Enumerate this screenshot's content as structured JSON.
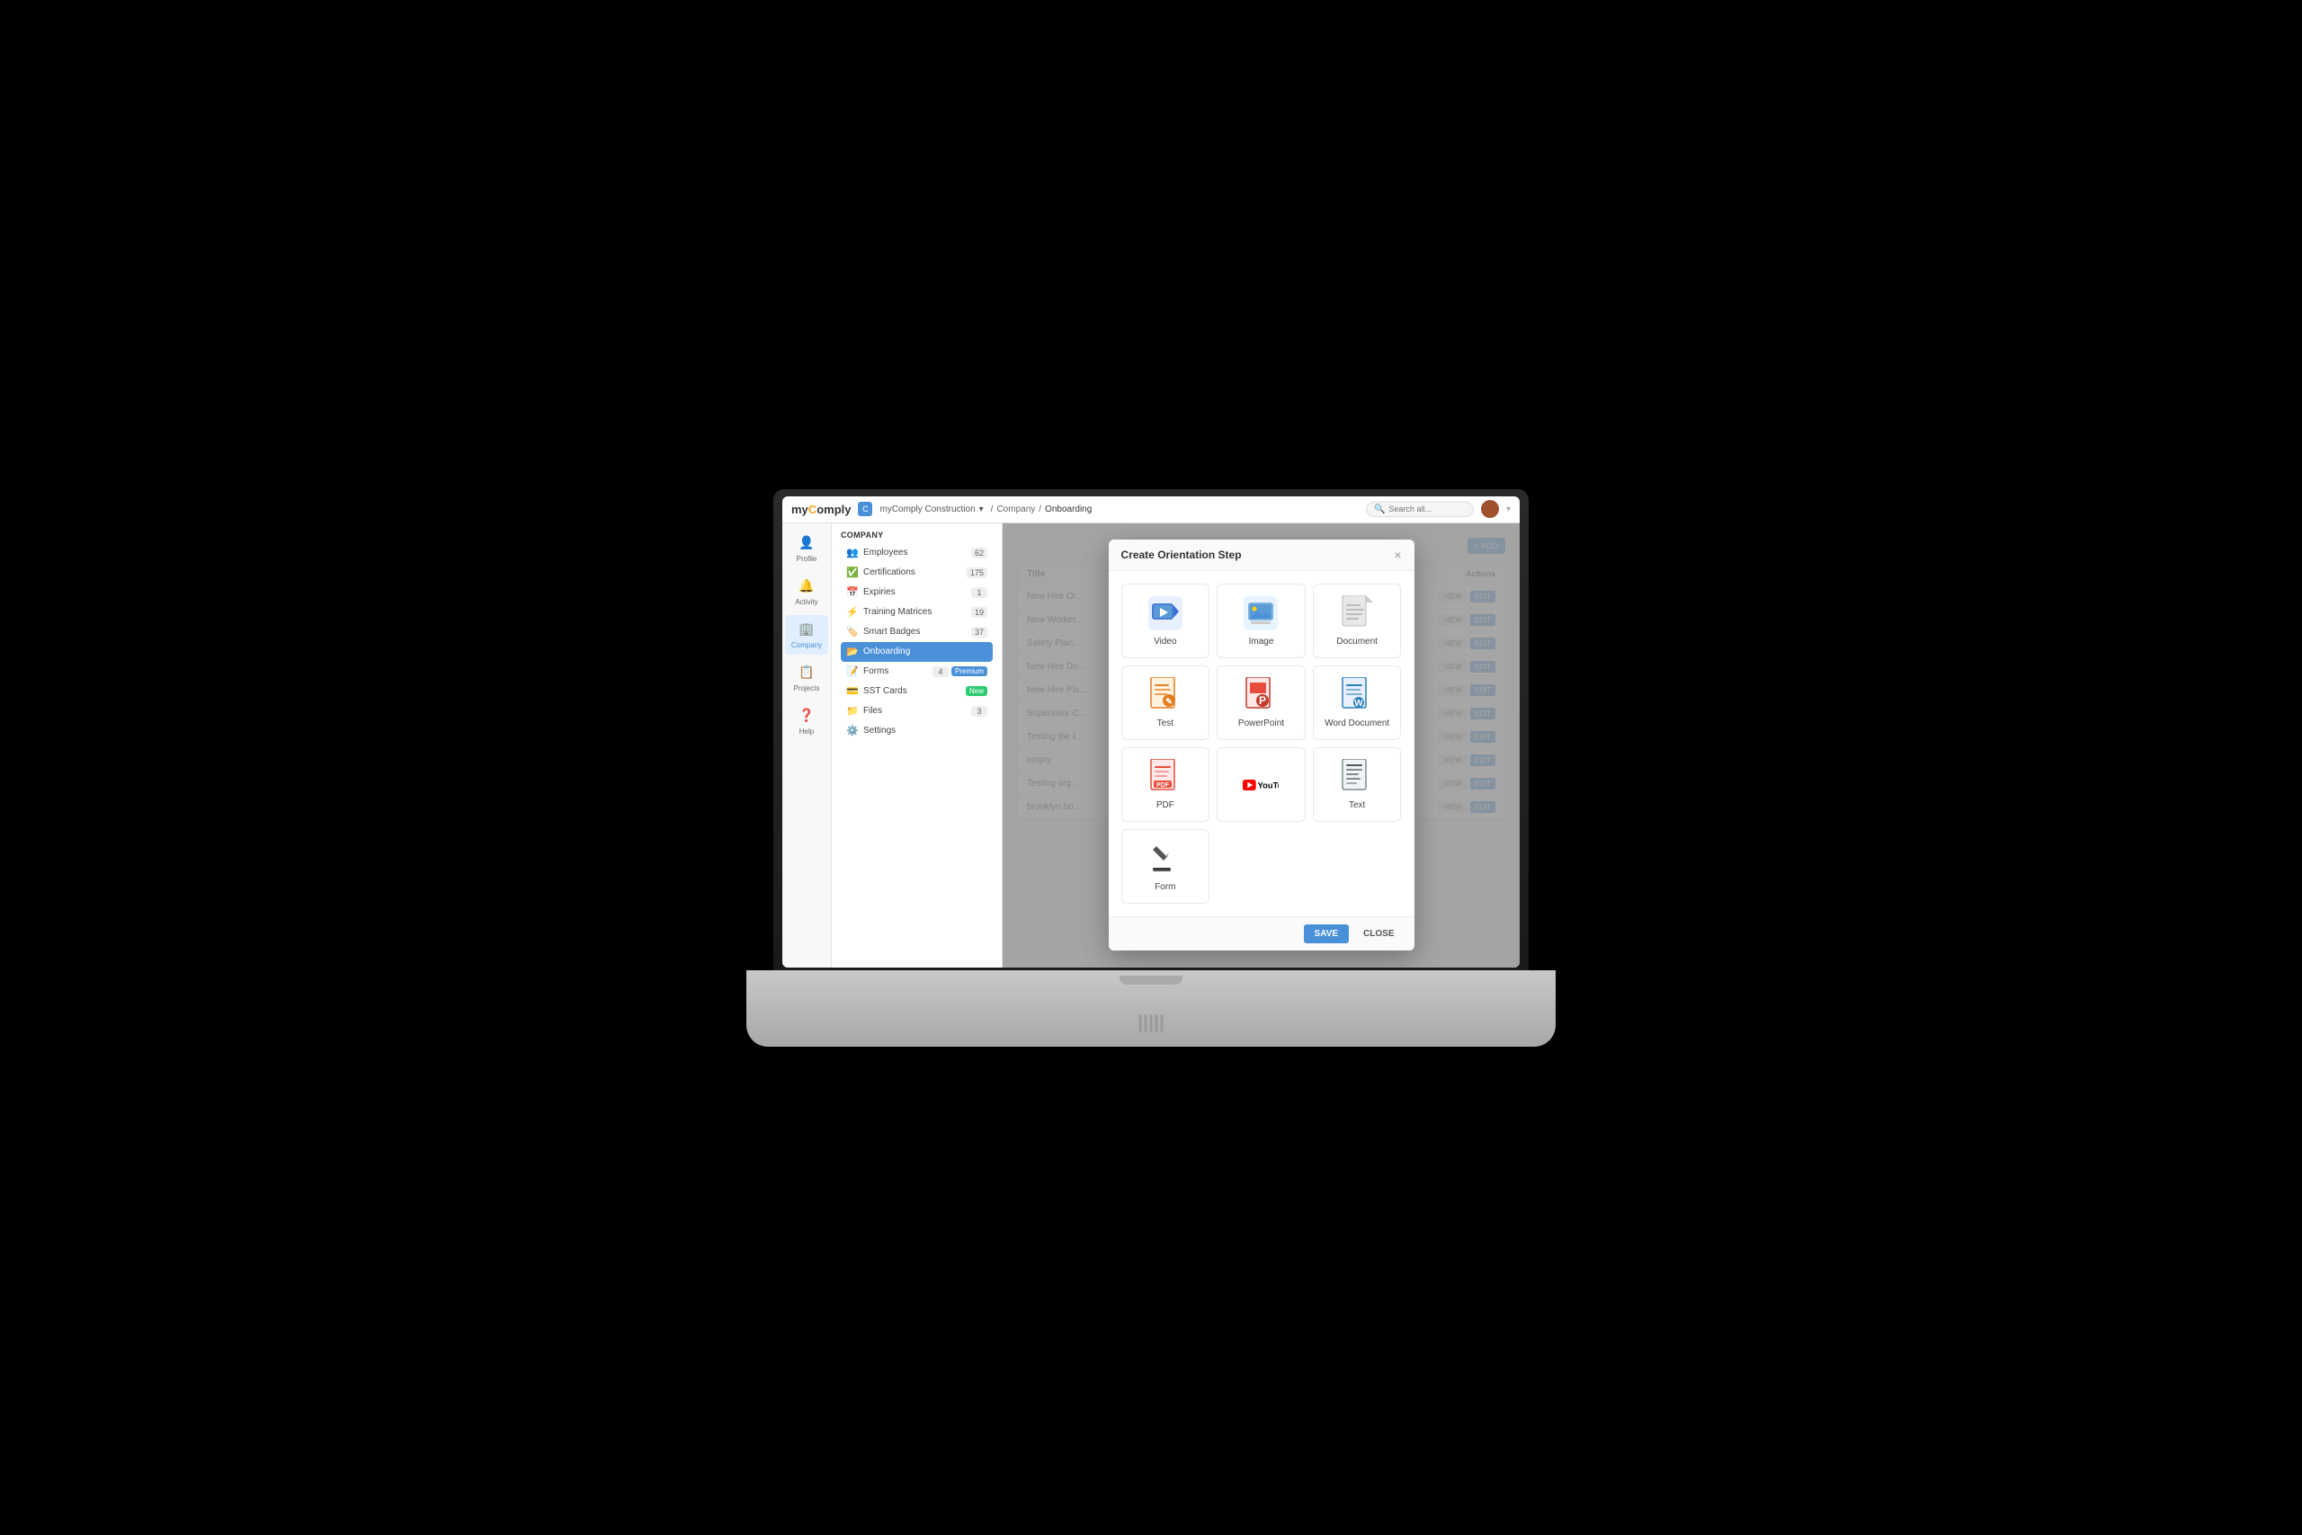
{
  "app": {
    "logo": "myComply",
    "logo_dot_color": "#f5a623"
  },
  "topbar": {
    "company_name": "myComply Construction",
    "breadcrumb": [
      "Company",
      "Onboarding"
    ],
    "search_placeholder": "Search all...",
    "dropdown_arrow": "▾"
  },
  "left_nav": {
    "items": [
      {
        "id": "profile",
        "label": "Profile",
        "icon": "👤"
      },
      {
        "id": "activity",
        "label": "Activity",
        "icon": "🔔"
      },
      {
        "id": "company",
        "label": "Company",
        "icon": "🏢",
        "active": true
      },
      {
        "id": "projects",
        "label": "Projects",
        "icon": "📋"
      },
      {
        "id": "help",
        "label": "Help",
        "icon": "❓"
      }
    ]
  },
  "sidebar": {
    "section_title": "Company",
    "items": [
      {
        "id": "employees",
        "label": "Employees",
        "count": "62",
        "icon": "👥"
      },
      {
        "id": "certifications",
        "label": "Certifications",
        "count": "175",
        "icon": "✅"
      },
      {
        "id": "expiries",
        "label": "Expiries",
        "count": "1",
        "icon": "📅"
      },
      {
        "id": "training-matrices",
        "label": "Training Matrices",
        "count": "19",
        "icon": "⚡"
      },
      {
        "id": "smart-badges",
        "label": "Smart Badges",
        "count": "37",
        "icon": "🏷️"
      },
      {
        "id": "onboarding",
        "label": "Onboarding",
        "active": true,
        "icon": "📂"
      },
      {
        "id": "forms",
        "label": "Forms",
        "count": "4",
        "badge": "Premium",
        "icon": "📝"
      },
      {
        "id": "sst-cards",
        "label": "SST Cards",
        "badge_new": "New",
        "icon": "💳"
      },
      {
        "id": "files",
        "label": "Files",
        "count": "3",
        "icon": "📁"
      },
      {
        "id": "settings",
        "label": "Settings",
        "icon": "⚙️"
      }
    ]
  },
  "content": {
    "page_title": "Onboarding",
    "add_button": "+ ADD",
    "table": {
      "columns": [
        "Title",
        "Actions"
      ],
      "rows": [
        {
          "title": "New Hire Or...",
          "view": "VIEW",
          "edit": "EDIT"
        },
        {
          "title": "New Worker...",
          "view": "VIEW",
          "edit": "EDIT"
        },
        {
          "title": "Safety Plan...",
          "view": "VIEW",
          "edit": "EDIT"
        },
        {
          "title": "New Hire Do...",
          "view": "VIEW",
          "edit": "EDIT"
        },
        {
          "title": "New Hire Pla...",
          "view": "VIEW",
          "edit": "EDIT"
        },
        {
          "title": "Supervisor C...",
          "view": "VIEW",
          "edit": "EDIT"
        },
        {
          "title": "Testing the t...",
          "view": "VIEW",
          "edit": "EDIT"
        },
        {
          "title": "empty",
          "view": "VIEW",
          "edit": "EDIT"
        },
        {
          "title": "Testing org...",
          "view": "VIEW",
          "edit": "EDIT"
        },
        {
          "title": "brooklyn bo...",
          "view": "VIEW",
          "edit": "EDIT"
        }
      ]
    }
  },
  "modal": {
    "title": "Create Orientation Step",
    "close_char": "×",
    "items": [
      {
        "id": "video",
        "label": "Video",
        "type": "video"
      },
      {
        "id": "image",
        "label": "Image",
        "type": "image"
      },
      {
        "id": "document",
        "label": "Document",
        "type": "document"
      },
      {
        "id": "test",
        "label": "Test",
        "type": "test"
      },
      {
        "id": "powerpoint",
        "label": "PowerPoint",
        "type": "powerpoint"
      },
      {
        "id": "word-document",
        "label": "Word Document",
        "type": "word"
      },
      {
        "id": "pdf",
        "label": "PDF",
        "type": "pdf"
      },
      {
        "id": "youtube",
        "label": "YouTube",
        "type": "youtube"
      },
      {
        "id": "text",
        "label": "Text",
        "type": "text"
      },
      {
        "id": "form",
        "label": "Form",
        "type": "form"
      }
    ],
    "save_label": "SAVE",
    "close_label": "CLOSE"
  }
}
